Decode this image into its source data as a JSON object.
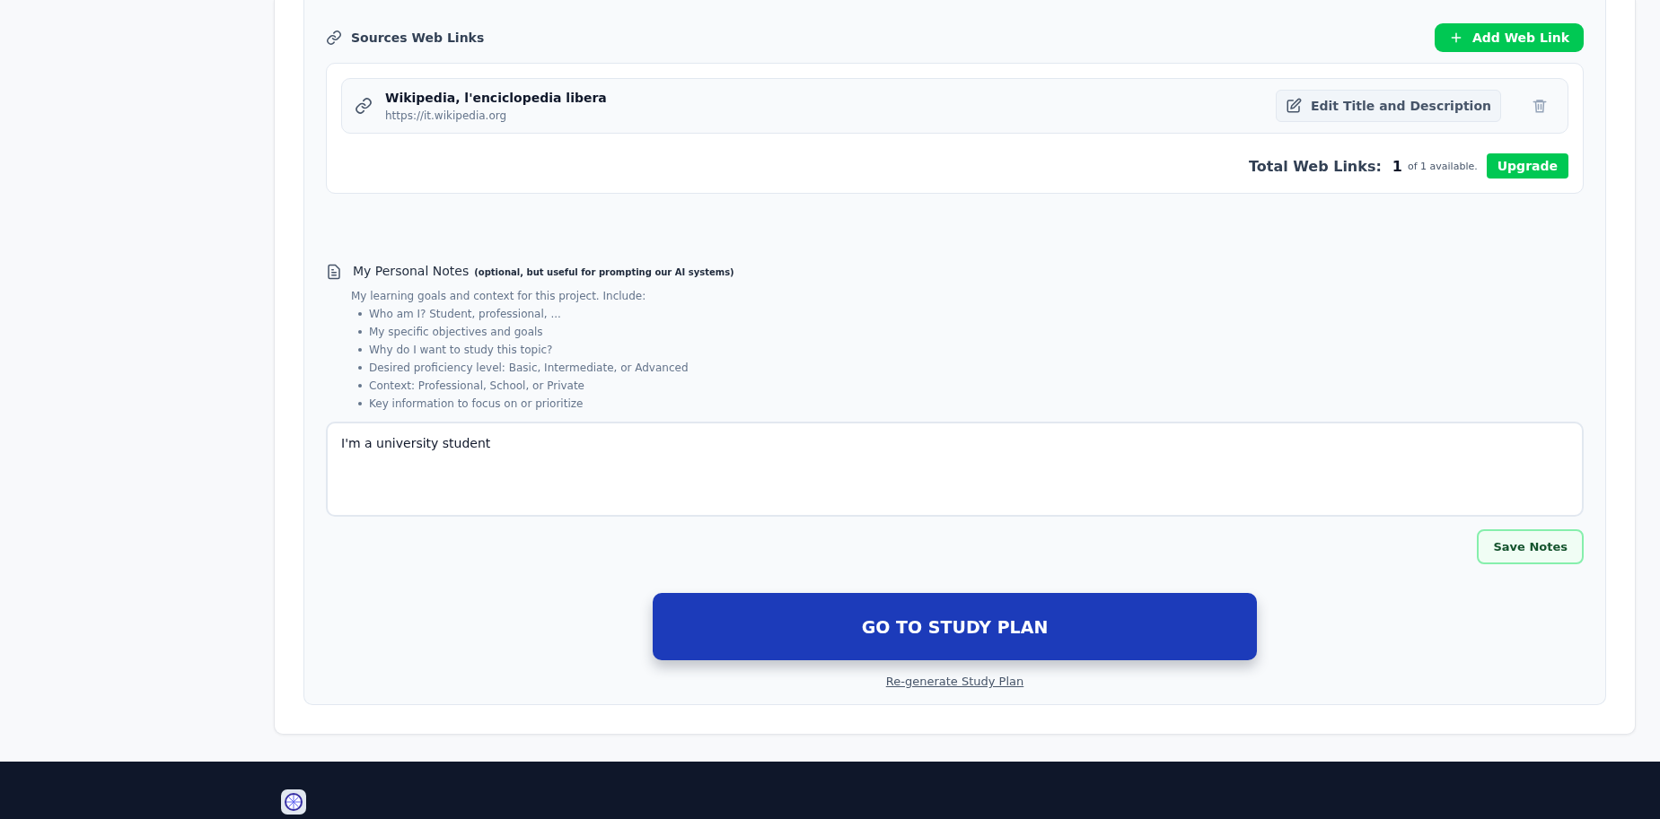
{
  "sources": {
    "title": "Sources Web Links",
    "add_button": "Add Web Link",
    "links": [
      {
        "title": "Wikipedia, l'enciclopedia libera",
        "url": "https://it.wikipedia.org",
        "edit_button": "Edit Title and Description"
      }
    ],
    "total_label": "Total Web Links:",
    "total_count": "1",
    "total_suffix": "of 1 available.",
    "upgrade_button": "Upgrade"
  },
  "notes": {
    "title": "My Personal Notes",
    "subtitle": "(optional, but useful for prompting our AI systems)",
    "intro": "My learning goals and context for this project. Include:",
    "hints": [
      "Who am I? Student, professional, ...",
      "My specific objectives and goals",
      "Why do I want to study this topic?",
      "Desired proficiency level: Basic, Intermediate, or Advanced",
      "Context: Professional, School, or Private",
      "Key information to focus on or prioritize"
    ],
    "value": "I'm a university student",
    "save_button": "Save Notes"
  },
  "study_button": "GO TO STUDY PLAN",
  "regenerate_link": "Re-generate Study Plan"
}
